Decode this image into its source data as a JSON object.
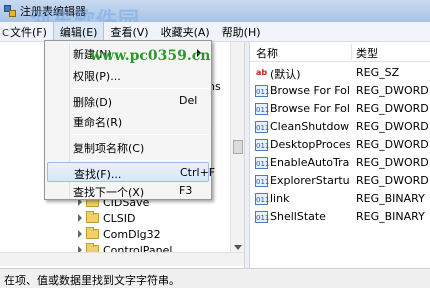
{
  "window": {
    "title": "注册表编辑器"
  },
  "watermark": {
    "text": "河东软件园",
    "url": "www.pc0359.cn"
  },
  "menubar": {
    "items": [
      {
        "label": "文件(F)"
      },
      {
        "label": "编辑(E)"
      },
      {
        "label": "查看(V)"
      },
      {
        "label": "收藏夹(A)"
      },
      {
        "label": "帮助(H)"
      }
    ]
  },
  "edit_menu": {
    "new": "新建(N)",
    "permissions": "权限(P)...",
    "delete": "删除(D)",
    "delete_shortcut": "Del",
    "rename": "重命名(R)",
    "copy_key_name": "复制项名称(C)",
    "find": "查找(F)...",
    "find_shortcut": "Ctrl+F",
    "find_next": "查找下一个(X)",
    "find_next_shortcut": "F3"
  },
  "tree": {
    "parent_label": "C",
    "partial_label": "ns",
    "items": [
      {
        "label": "CIDSave"
      },
      {
        "label": "CLSID"
      },
      {
        "label": "ComDlg32"
      },
      {
        "label": "ControlPanel"
      }
    ]
  },
  "values": {
    "col_name": "名称",
    "col_type": "类型",
    "rows": [
      {
        "icon": "string-value-icon",
        "glyph": "ab",
        "name": "(默认)",
        "type": "REG_SZ"
      },
      {
        "icon": "binary-value-icon",
        "glyph": "011",
        "name": "Browse For Fol...",
        "type": "REG_DWORD"
      },
      {
        "icon": "binary-value-icon",
        "glyph": "011",
        "name": "Browse For Fol...",
        "type": "REG_DWORD"
      },
      {
        "icon": "binary-value-icon",
        "glyph": "011",
        "name": "CleanShutdown",
        "type": "REG_DWORD"
      },
      {
        "icon": "binary-value-icon",
        "glyph": "011",
        "name": "DesktopProcess",
        "type": "REG_DWORD"
      },
      {
        "icon": "binary-value-icon",
        "glyph": "011",
        "name": "EnableAutoTray",
        "type": "REG_DWORD"
      },
      {
        "icon": "binary-value-icon",
        "glyph": "011",
        "name": "ExplorerStartu...",
        "type": "REG_DWORD"
      },
      {
        "icon": "binary-value-icon",
        "glyph": "011",
        "name": "link",
        "type": "REG_BINARY"
      },
      {
        "icon": "binary-value-icon",
        "glyph": "011",
        "name": "ShellState",
        "type": "REG_BINARY"
      }
    ]
  },
  "statusbar": {
    "text": "在项、值或数据里找到文字字符串。"
  }
}
